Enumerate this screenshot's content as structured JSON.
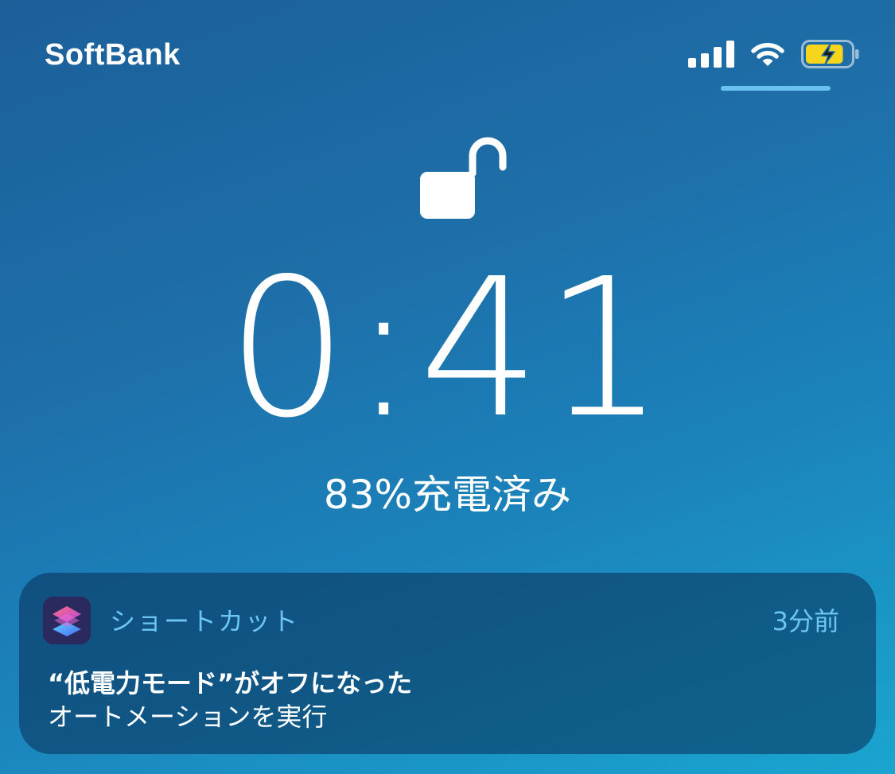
{
  "status_bar": {
    "carrier": "SoftBank",
    "signal_bars": 4,
    "wifi": "wifi-icon",
    "battery": {
      "icon": "battery-charging-icon",
      "fill_color": "#f7d51d",
      "level_fraction": 0.83
    }
  },
  "lock_screen": {
    "lock_state_icon": "unlocked-padlock-icon",
    "time": "0:41",
    "charge_text": "83%充電済み"
  },
  "notification": {
    "app_icon": "shortcuts-app-icon",
    "app_name": "ショートカット",
    "timestamp": "3分前",
    "title": "“低電力モード”がオフになった",
    "body": "オートメーションを実行"
  },
  "colors": {
    "accent_text": "#6cc5f2",
    "battery_fill": "#f7d51d"
  }
}
